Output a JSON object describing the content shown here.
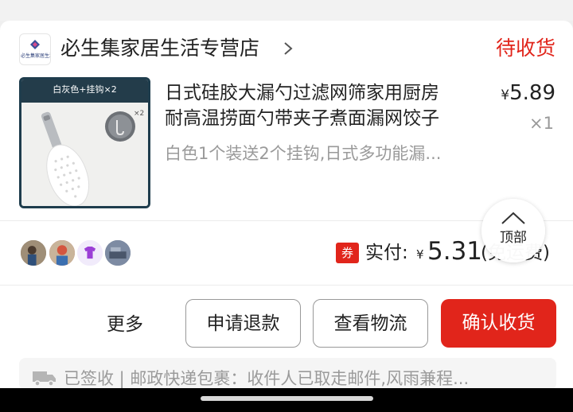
{
  "shop": {
    "logo_text": "必生集家居生活",
    "name": "必生集家居生活专营店",
    "order_status": "待收货"
  },
  "product": {
    "image_banner": "白灰色+挂钩×2",
    "image_badge": "×2",
    "title_line1": "日式硅胶大漏勺过滤网筛家用厨房",
    "title_line2": "耐高温捞面勺带夹子煮面漏网饺子",
    "spec": "白色1个装送2个挂钩,日式多功能漏...",
    "price_symbol": "¥",
    "price": "5.89",
    "quantity": "×1"
  },
  "payment": {
    "coupon_badge": "券",
    "label": "实付:",
    "symbol": "¥",
    "amount": "5.31",
    "note": "(免运费)"
  },
  "scroll_top": {
    "label": "顶部"
  },
  "actions": {
    "more": "更多",
    "refund": "申请退款",
    "logistics": "查看物流",
    "confirm": "确认收货"
  },
  "logistics": {
    "text": "已签收 | 邮政快递包裹：收件人已取走邮件,风雨兼程..."
  },
  "colors": {
    "accent": "#e1251b",
    "muted_text": "#9a9a9a"
  },
  "icons": [
    "chevron-right-icon",
    "chevron-up-icon",
    "truck-icon"
  ]
}
